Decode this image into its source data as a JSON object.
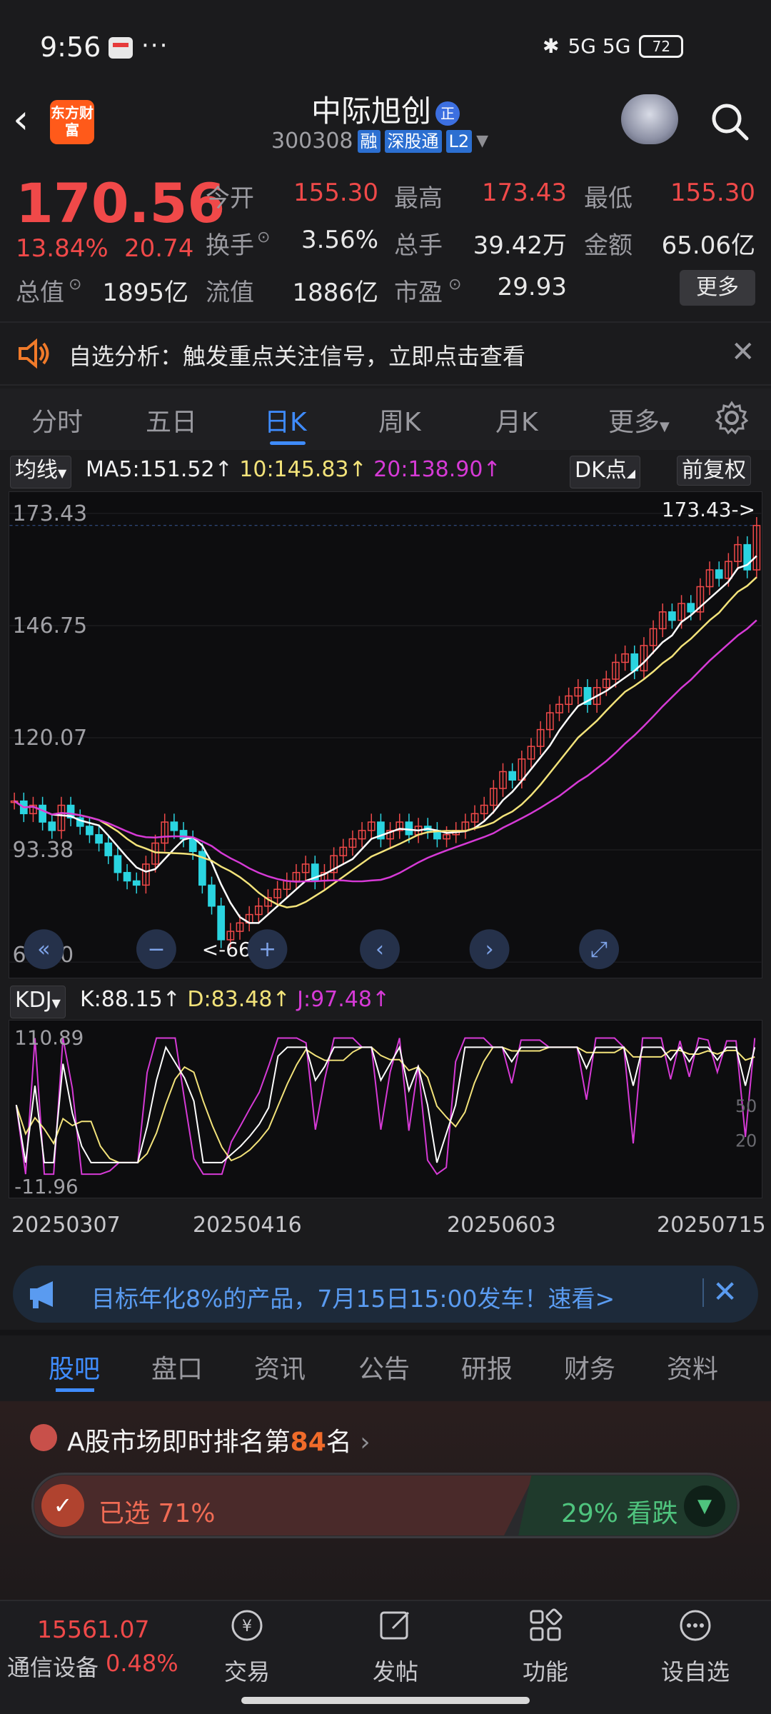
{
  "status_bar": {
    "time": "9:56",
    "dots": "···",
    "network": "5G 5G",
    "battery": "72"
  },
  "header": {
    "logo_text": "东方财富",
    "stock_name": "中际旭创",
    "name_badge": "正",
    "code": "300308",
    "tags": [
      "融",
      "深股通",
      "L2"
    ]
  },
  "quote": {
    "price": "170.56",
    "pct": "13.84%",
    "change": "20.74",
    "rows": [
      [
        {
          "label": "今开",
          "value": "155.30",
          "color": "red"
        },
        {
          "label": "最高",
          "value": "173.43",
          "color": "red"
        },
        {
          "label": "最低",
          "value": "155.30",
          "color": "red"
        }
      ],
      [
        {
          "label": "换手",
          "value": "3.56%",
          "color": "white"
        },
        {
          "label": "总手",
          "value": "39.42万",
          "color": "white"
        },
        {
          "label": "金额",
          "value": "65.06亿",
          "color": "white"
        }
      ],
      [
        {
          "label": "总值",
          "value": "1895亿",
          "color": "white"
        },
        {
          "label": "流值",
          "value": "1886亿",
          "color": "white"
        },
        {
          "label": "市盈",
          "value": "29.93",
          "color": "white"
        }
      ]
    ],
    "more_label": "更多"
  },
  "notice": {
    "text": "自选分析：触发重点关注信号，立即点击查看"
  },
  "period_tabs": [
    "分时",
    "五日",
    "日K",
    "周K",
    "月K",
    "更多"
  ],
  "active_period": "日K",
  "indicators": {
    "ma_select": "均线",
    "ma5": "MA5:151.52",
    "ma10": "10:145.83",
    "ma20": "20:138.90",
    "dk_label": "DK点",
    "adjust_label": "前复权"
  },
  "kchart_labels": {
    "y_ticks": [
      "173.43",
      "146.75",
      "120.07",
      "93.38",
      "66.70"
    ],
    "high_marker": "173.43->",
    "low_marker": "<-66.70"
  },
  "kdj": {
    "select": "KDJ",
    "k": "K:88.15",
    "d": "D:83.48",
    "j": "J:97.48",
    "y_top": "110.89",
    "y_bottom": "-11.96",
    "mark_50": "50",
    "mark_20": "20"
  },
  "dates": [
    "20250307",
    "20250416",
    "20250603",
    "20250715"
  ],
  "chart_data": {
    "type": "candlestick",
    "title": "",
    "ylim": [
      66.7,
      173.43
    ],
    "series": [
      {
        "name": "MA5",
        "value_last": 151.52,
        "color": "#ffffff"
      },
      {
        "name": "MA10",
        "value_last": 145.83,
        "color": "#f3e37a"
      },
      {
        "name": "MA20",
        "value_last": 138.9,
        "color": "#d63ad6"
      }
    ],
    "close_approx": [
      105,
      102,
      104,
      100,
      98,
      104,
      101,
      99,
      97,
      95,
      92,
      88,
      86,
      85,
      90,
      95,
      100,
      98,
      96,
      93,
      85,
      80,
      72,
      74,
      76,
      78,
      80,
      82,
      84,
      86,
      88,
      90,
      86,
      88,
      92,
      94,
      96,
      98,
      100,
      96,
      98,
      100,
      97,
      99,
      98,
      96,
      97,
      98,
      100,
      102,
      104,
      108,
      112,
      110,
      115,
      118,
      122,
      126,
      128,
      130,
      132,
      128,
      132,
      134,
      138,
      140,
      136,
      142,
      146,
      150,
      148,
      152,
      150,
      156,
      160,
      158,
      162,
      166,
      160,
      170.56
    ]
  },
  "ad": {
    "text": "目标年化8%的产品，7月15日15:00发车！速看>"
  },
  "bottom_tabs": [
    "股吧",
    "盘口",
    "资讯",
    "公告",
    "研报",
    "财务",
    "资料"
  ],
  "rank": {
    "prefix": "A股市场即时排名第",
    "number": "84",
    "suffix": "名",
    "up_text": "已选 71%",
    "down_text": "29% 看跌"
  },
  "index": {
    "value": "15561.07",
    "name": "通信设备",
    "pct": "0.48%"
  },
  "nav": [
    "交易",
    "发帖",
    "功能",
    "设自选"
  ],
  "colors": {
    "up": "#f04949",
    "down": "#27b36c",
    "accent": "#3f8cff"
  }
}
